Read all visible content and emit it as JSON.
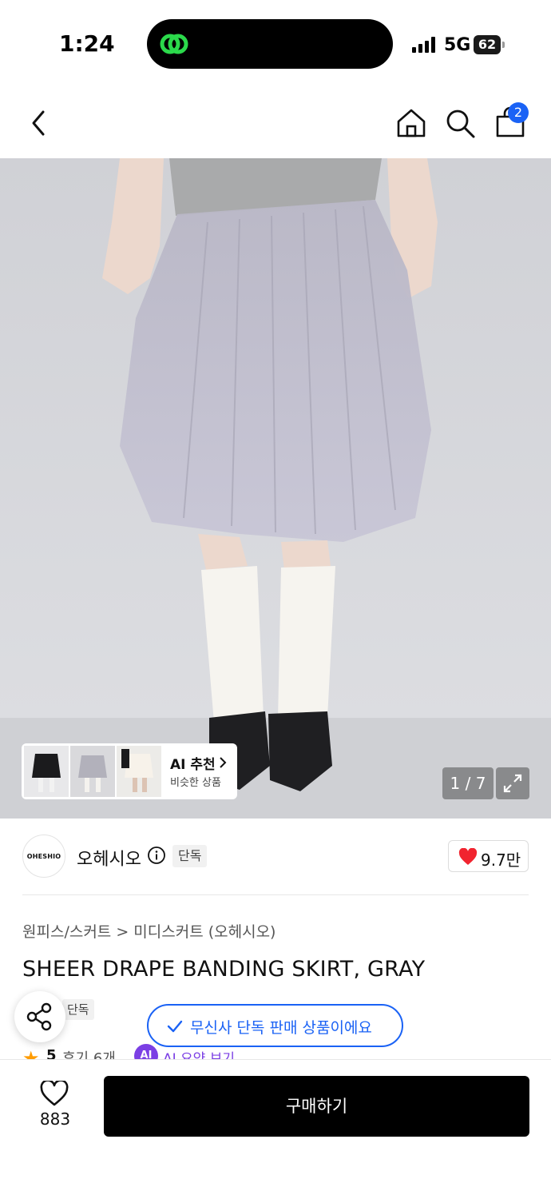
{
  "status_bar": {
    "time": "1:24",
    "network": "5G",
    "battery": "62"
  },
  "nav": {
    "back_icon": "chevron-left-icon",
    "home_icon": "home-icon",
    "search_icon": "search-icon",
    "cart_icon": "shopping-bag-icon",
    "cart_badge": "2"
  },
  "gallery": {
    "ai_title": "AI 추천",
    "ai_subtitle": "비슷한 상품",
    "counter": "1 / 7",
    "expand_icon": "expand-icon"
  },
  "brand": {
    "logo_text": "OHESHIO",
    "name": "오헤시오",
    "tag": "단독",
    "likes": "9.7만"
  },
  "product": {
    "breadcrumb": "원피스/스커트 > 미디스커트 (오헤시오)",
    "title": "SHEER DRAPE BANDING SKIRT, GRAY",
    "tag": "단독",
    "rating": "5",
    "review": "후기 6개",
    "ai_badge": "AI",
    "ai_link": "AI 요약 보기"
  },
  "notice": {
    "text": "무신사 단독 판매 상품이에요"
  },
  "bottom": {
    "wish_count": "883",
    "buy_label": "구매하기"
  },
  "colors": {
    "accent": "#1a62f5",
    "heart": "#f1242f",
    "ai_purple": "#7b3fe4"
  }
}
